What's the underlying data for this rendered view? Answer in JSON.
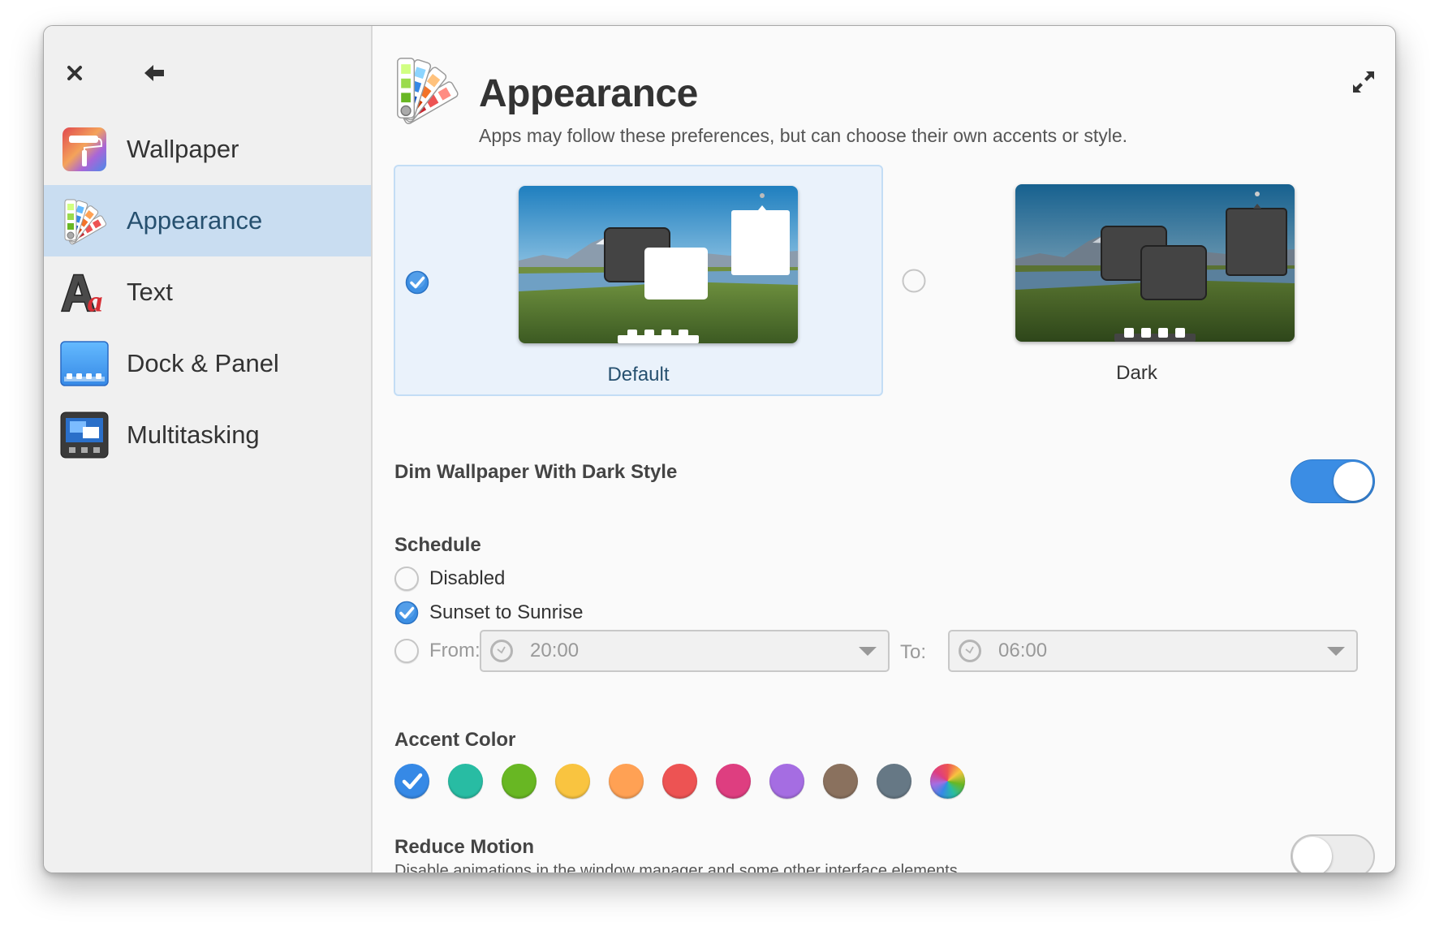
{
  "window": {
    "close_label": "Close",
    "back_label": "Back",
    "expand_label": "Maximize"
  },
  "sidebar": {
    "items": [
      {
        "label": "Wallpaper",
        "icon": "wallpaper-roller-icon",
        "active": false
      },
      {
        "label": "Appearance",
        "icon": "color-swatch-fan-icon",
        "active": true
      },
      {
        "label": "Text",
        "icon": "font-aa-icon",
        "active": false
      },
      {
        "label": "Dock & Panel",
        "icon": "dock-panel-icon",
        "active": false
      },
      {
        "label": "Multitasking",
        "icon": "multitasking-icon",
        "active": false
      }
    ]
  },
  "header": {
    "title": "Appearance",
    "subtitle": "Apps may follow these preferences, but can choose their own accents or style."
  },
  "styles": {
    "options": [
      {
        "label": "Default",
        "selected": true
      },
      {
        "label": "Dark",
        "selected": false
      }
    ]
  },
  "dim_wallpaper": {
    "label": "Dim Wallpaper With Dark Style",
    "enabled": true
  },
  "schedule": {
    "title": "Schedule",
    "options": [
      {
        "label": "Disabled",
        "selected": false
      },
      {
        "label": "Sunset to Sunrise",
        "selected": true
      },
      {
        "label": "From:",
        "selected": false
      }
    ],
    "from_value": "20:00",
    "to_label": "To:",
    "to_value": "06:00"
  },
  "accent": {
    "title": "Accent Color",
    "colors": [
      {
        "name": "blue",
        "hex": "#3689e6",
        "selected": true
      },
      {
        "name": "mint",
        "hex": "#28bca3",
        "selected": false
      },
      {
        "name": "lime",
        "hex": "#68b723",
        "selected": false
      },
      {
        "name": "banana",
        "hex": "#f9c440",
        "selected": false
      },
      {
        "name": "orange",
        "hex": "#ffa154",
        "selected": false
      },
      {
        "name": "strawberry",
        "hex": "#ed5353",
        "selected": false
      },
      {
        "name": "bubblegum",
        "hex": "#de3e80",
        "selected": false
      },
      {
        "name": "grape",
        "hex": "#a56de2",
        "selected": false
      },
      {
        "name": "cocoa",
        "hex": "#8a715e",
        "selected": false
      },
      {
        "name": "slate",
        "hex": "#667885",
        "selected": false
      },
      {
        "name": "auto",
        "hex": "multicolor",
        "selected": false
      }
    ]
  },
  "reduce_motion": {
    "label": "Reduce Motion",
    "description": "Disable animations in the window manager and some other interface elements.",
    "enabled": false
  }
}
